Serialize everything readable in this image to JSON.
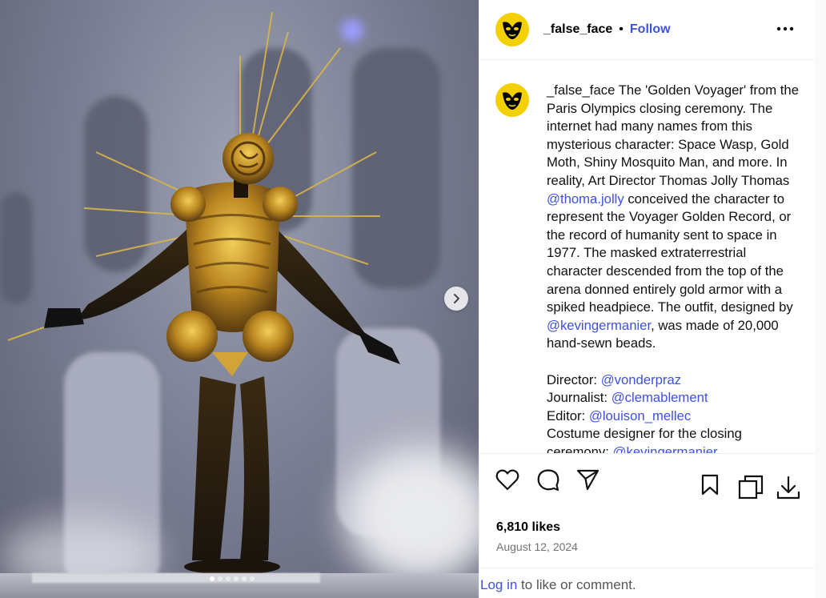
{
  "post": {
    "username": "_false_face",
    "separator": "•",
    "follow_label": "Follow",
    "more_icon": "more-horizontal-icon",
    "caption": {
      "username": "_false_face",
      "text_1": " The 'Golden Voyager' from the Paris Olympics closing ceremony. The internet had many names from this mysterious character: Space Wasp, Gold Moth, Shiny Mosquito Man, and more. In reality, Art Director Thomas Jolly Thomas ",
      "mention_1": "@thoma.jolly",
      "text_2": " conceived the character to represent the Voyager Golden Record, or the record of humanity sent to space in 1977. The masked extraterrestrial character descended from the top of the arena donned entirely gold armor with a spiked headpiece. The outfit, designed by ",
      "mention_2": "@kevingermanier",
      "text_3": ", was made of 20,000 hand-sewn beads.",
      "credits": [
        {
          "label": "Director: ",
          "mention": "@vonderpraz"
        },
        {
          "label": "Journalist: ",
          "mention": "@clemablement"
        },
        {
          "label": "Editor: ",
          "mention": "@louison_mellec"
        },
        {
          "label": "Costume designer for the closing ceremony: ",
          "mention": "@kevingermanier"
        }
      ]
    },
    "likes": "6,810 likes",
    "date": "August 12, 2024",
    "login_link": "Log in",
    "login_text": " to like or comment.",
    "carousel": {
      "slide_count": 6,
      "active_index": 0
    }
  },
  "colors": {
    "accent": "#3f51e0",
    "avatar_bg": "#f5d000",
    "muted": "#737373"
  }
}
